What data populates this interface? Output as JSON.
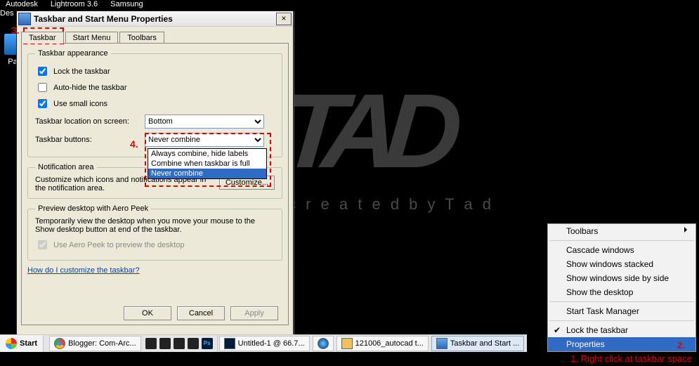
{
  "desktop_top": {
    "items": [
      "Autodesk",
      "Lightroom 3.6",
      "Samsung"
    ],
    "side": "Des",
    "icon_label": "Pa"
  },
  "watermark": {
    "big": "TAD",
    "sub": "c r e a t e d   b y   T a d"
  },
  "dialog": {
    "title": "Taskbar and Start Menu Properties",
    "close_label": "×",
    "tabs": [
      "Taskbar",
      "Start Menu",
      "Toolbars"
    ],
    "active_tab": 0,
    "appearance_legend": "Taskbar appearance",
    "lock_label": "Lock the taskbar",
    "lock_checked": true,
    "autohide_label": "Auto-hide the taskbar",
    "autohide_checked": false,
    "smallicons_label": "Use small icons",
    "smallicons_checked": true,
    "location_label": "Taskbar location on screen:",
    "location_value": "Bottom",
    "buttons_label": "Taskbar buttons:",
    "buttons_value": "Never combine",
    "buttons_options": [
      "Always combine, hide labels",
      "Combine when taskbar is full",
      "Never combine"
    ],
    "notif_legend": "Notification area",
    "notif_text": "Customize which icons and notifications appear in the notification area.",
    "customize_label": "Customize...",
    "peek_legend": "Preview desktop with Aero Peek",
    "peek_text": "Temporarily view the desktop when you move your mouse to the Show desktop button at end of the taskbar.",
    "peek_check_label": "Use Aero Peek to preview the desktop",
    "peek_disabled": true,
    "help_link": "How do I customize the taskbar?",
    "ok_label": "OK",
    "cancel_label": "Cancel",
    "apply_label": "Apply"
  },
  "annotations": {
    "step3": "3.",
    "step4": "4.",
    "step2": "2.",
    "step1": "1. Right click at taskbar space"
  },
  "contextmenu": {
    "items": [
      {
        "label": "Toolbars",
        "submenu": true
      },
      {
        "sep": true
      },
      {
        "label": "Cascade windows"
      },
      {
        "label": "Show windows stacked"
      },
      {
        "label": "Show windows side by side"
      },
      {
        "label": "Show the desktop"
      },
      {
        "sep": true
      },
      {
        "label": "Start Task Manager"
      },
      {
        "sep": true
      },
      {
        "label": "Lock the taskbar",
        "checked": true
      },
      {
        "label": "Properties",
        "highlight": true
      }
    ]
  },
  "taskbar": {
    "start_label": "Start",
    "ql_icons": [
      "chrome-icon",
      "empty-box-icon",
      "firewall-icon",
      "alien-icon",
      "pen-icon",
      "ps-icon"
    ],
    "tasks": [
      {
        "label": "Blogger: Com-Arc...",
        "icon": "chrome"
      },
      {
        "label": "Untitled-1 @ 66.7...",
        "icon": "ps"
      },
      {
        "label": "",
        "icon": "itunes",
        "narrow": true
      },
      {
        "label": "121006_autocad t...",
        "icon": "folder"
      },
      {
        "label": "Taskbar and Start ...",
        "icon": "dark",
        "active": true
      }
    ]
  }
}
